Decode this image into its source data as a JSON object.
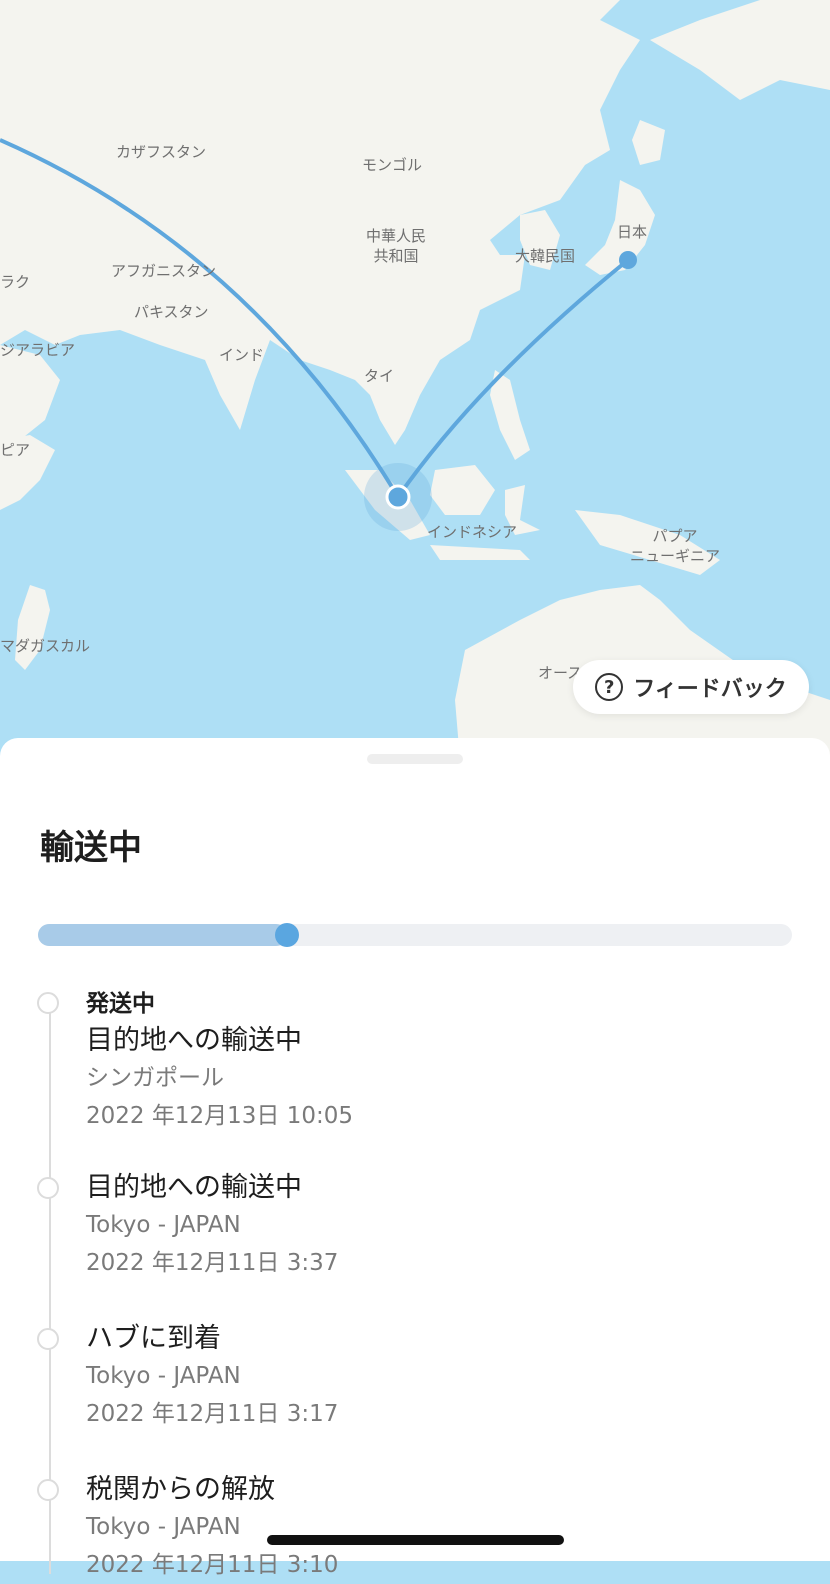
{
  "map": {
    "labels": [
      {
        "id": "kazakhstan",
        "text": "カザフスタン"
      },
      {
        "id": "mongolia",
        "text": "モンゴル"
      },
      {
        "id": "china",
        "text": "中華人民\n共和国"
      },
      {
        "id": "japan",
        "text": "日本"
      },
      {
        "id": "korea",
        "text": "大韓民国"
      },
      {
        "id": "iraq",
        "text": "ラク"
      },
      {
        "id": "afghanistan",
        "text": "アフガニスタン"
      },
      {
        "id": "pakistan",
        "text": "パキスタン"
      },
      {
        "id": "saudi",
        "text": "ジアラビア"
      },
      {
        "id": "india",
        "text": "インド"
      },
      {
        "id": "thailand",
        "text": "タイ"
      },
      {
        "id": "ethiopia",
        "text": "ピア"
      },
      {
        "id": "indonesia",
        "text": "インドネシア"
      },
      {
        "id": "png",
        "text": "パプア\nニューギニア"
      },
      {
        "id": "madagascar",
        "text": "マダガスカル"
      },
      {
        "id": "australia",
        "text": "オース"
      }
    ],
    "route_color": "#5ea7dd",
    "land_color": "#f4f4ef",
    "sea_color": "#aedff5"
  },
  "feedback": {
    "label": "フィードバック",
    "icon": "question-circle-icon"
  },
  "sheet": {
    "title": "輸送中",
    "progress": 0.33,
    "events": [
      {
        "label": "発送中",
        "title": "目的地への輸送中",
        "location": "シンガポール",
        "datetime": "2022 年12月13日  10:05"
      },
      {
        "label": "",
        "title": "目的地への輸送中",
        "location": "Tokyo - JAPAN",
        "datetime": "2022 年12月11日  3:37"
      },
      {
        "label": "",
        "title": "ハブに到着",
        "location": "Tokyo - JAPAN",
        "datetime": "2022 年12月11日  3:17"
      },
      {
        "label": "",
        "title": "税関からの解放",
        "location": "Tokyo - JAPAN",
        "datetime": "2022 年12月11日  3:10"
      }
    ]
  }
}
